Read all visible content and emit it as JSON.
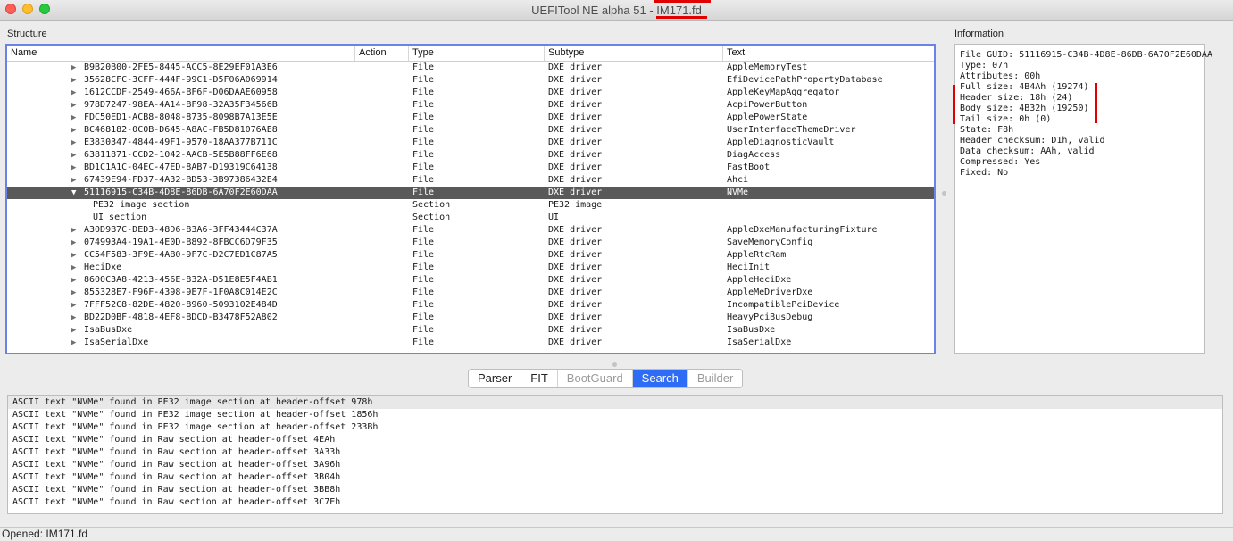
{
  "window": {
    "title_prefix": "UEFITool NE alpha 51 - ",
    "title_file": "IM171.fd"
  },
  "labels": {
    "structure": "Structure",
    "information": "Information"
  },
  "tree": {
    "columns": [
      "Name",
      "Action",
      "Type",
      "Subtype",
      "Text"
    ],
    "rows": [
      {
        "name": "B9B20B00-2FE5-8445-ACC5-8E29EF01A3E6",
        "action": "",
        "type": "File",
        "subtype": "DXE driver",
        "text": "AppleMemoryTest",
        "arrow": "▶"
      },
      {
        "name": "35628CFC-3CFF-444F-99C1-D5F06A069914",
        "action": "",
        "type": "File",
        "subtype": "DXE driver",
        "text": "EfiDevicePathPropertyDatabase",
        "arrow": "▶"
      },
      {
        "name": "1612CCDF-2549-466A-BF6F-D06DAAE60958",
        "action": "",
        "type": "File",
        "subtype": "DXE driver",
        "text": "AppleKeyMapAggregator",
        "arrow": "▶"
      },
      {
        "name": "978D7247-98EA-4A14-BF98-32A35F34566B",
        "action": "",
        "type": "File",
        "subtype": "DXE driver",
        "text": "AcpiPowerButton",
        "arrow": "▶"
      },
      {
        "name": "FDC50ED1-ACB8-8048-8735-8098B7A13E5E",
        "action": "",
        "type": "File",
        "subtype": "DXE driver",
        "text": "ApplePowerState",
        "arrow": "▶"
      },
      {
        "name": "BC468182-0C0B-D645-A8AC-FB5D81076AE8",
        "action": "",
        "type": "File",
        "subtype": "DXE driver",
        "text": "UserInterfaceThemeDriver",
        "arrow": "▶"
      },
      {
        "name": "E3830347-4844-49F1-9570-18AA377B711C",
        "action": "",
        "type": "File",
        "subtype": "DXE driver",
        "text": "AppleDiagnosticVault",
        "arrow": "▶"
      },
      {
        "name": "63811871-CCD2-1042-AACB-5E5B88FF6E68",
        "action": "",
        "type": "File",
        "subtype": "DXE driver",
        "text": "DiagAccess",
        "arrow": "▶"
      },
      {
        "name": "BD1C1A1C-04EC-47ED-8AB7-D19319C64138",
        "action": "",
        "type": "File",
        "subtype": "DXE driver",
        "text": "FastBoot",
        "arrow": "▶"
      },
      {
        "name": "67439E94-FD37-4A32-BD53-3B97386432E4",
        "action": "",
        "type": "File",
        "subtype": "DXE driver",
        "text": "Ahci",
        "arrow": "▶"
      },
      {
        "name": "51116915-C34B-4D8E-86DB-6A70F2E60DAA",
        "action": "",
        "type": "File",
        "subtype": "DXE driver",
        "text": "NVMe",
        "arrow": "▼",
        "selected": true
      },
      {
        "name": "PE32 image section",
        "action": "",
        "type": "Section",
        "subtype": "PE32 image",
        "text": "",
        "arrow": "",
        "child": true
      },
      {
        "name": "UI section",
        "action": "",
        "type": "Section",
        "subtype": "UI",
        "text": "",
        "arrow": "",
        "child": true
      },
      {
        "name": "A30D9B7C-DED3-48D6-83A6-3FF43444C37A",
        "action": "",
        "type": "File",
        "subtype": "DXE driver",
        "text": "AppleDxeManufacturingFixture",
        "arrow": "▶"
      },
      {
        "name": "074993A4-19A1-4E0D-B892-8FBCC6D79F35",
        "action": "",
        "type": "File",
        "subtype": "DXE driver",
        "text": "SaveMemoryConfig",
        "arrow": "▶"
      },
      {
        "name": "CC54F583-3F9E-4AB0-9F7C-D2C7ED1C87A5",
        "action": "",
        "type": "File",
        "subtype": "DXE driver",
        "text": "AppleRtcRam",
        "arrow": "▶"
      },
      {
        "name": "HeciDxe",
        "action": "",
        "type": "File",
        "subtype": "DXE driver",
        "text": "HeciInit",
        "arrow": "▶"
      },
      {
        "name": "8600C3A8-4213-456E-832A-D51E8E5F4AB1",
        "action": "",
        "type": "File",
        "subtype": "DXE driver",
        "text": "AppleHeciDxe",
        "arrow": "▶"
      },
      {
        "name": "855328E7-F96F-4398-9E7F-1F0A8C014E2C",
        "action": "",
        "type": "File",
        "subtype": "DXE driver",
        "text": "AppleMeDriverDxe",
        "arrow": "▶"
      },
      {
        "name": "7FFF52C8-82DE-4820-8960-5093102E484D",
        "action": "",
        "type": "File",
        "subtype": "DXE driver",
        "text": "IncompatiblePciDevice",
        "arrow": "▶"
      },
      {
        "name": "BD22D0BF-4818-4EF8-BDCD-B3478F52A802",
        "action": "",
        "type": "File",
        "subtype": "DXE driver",
        "text": "HeavyPciBusDebug",
        "arrow": "▶"
      },
      {
        "name": "IsaBusDxe",
        "action": "",
        "type": "File",
        "subtype": "DXE driver",
        "text": "IsaBusDxe",
        "arrow": "▶"
      },
      {
        "name": "IsaSerialDxe",
        "action": "",
        "type": "File",
        "subtype": "DXE driver",
        "text": "IsaSerialDxe",
        "arrow": "▶"
      }
    ]
  },
  "info": {
    "lines": [
      "File GUID: 51116915-C34B-4D8E-86DB-6A70F2E60DAA",
      "Type: 07h",
      "Attributes: 00h",
      "Full size: 4B4Ah (19274)",
      "Header size: 18h (24)",
      "Body size: 4B32h (19250)",
      "Tail size: 0h (0)",
      "State: F8h",
      "Header checksum: D1h, valid",
      "Data checksum: AAh, valid",
      "Compressed: Yes",
      "Fixed: No"
    ]
  },
  "tabs": [
    {
      "label": "Parser",
      "state": "normal"
    },
    {
      "label": "FIT",
      "state": "normal"
    },
    {
      "label": "BootGuard",
      "state": "disabled"
    },
    {
      "label": "Search",
      "state": "active"
    },
    {
      "label": "Builder",
      "state": "disabled"
    }
  ],
  "messages": [
    "ASCII text \"NVMe\" found in PE32 image section at header-offset 978h",
    "ASCII text \"NVMe\" found in PE32 image section at header-offset 1856h",
    "ASCII text \"NVMe\" found in PE32 image section at header-offset 233Bh",
    "ASCII text \"NVMe\" found in Raw section at header-offset 4EAh",
    "ASCII text \"NVMe\" found in Raw section at header-offset 3A33h",
    "ASCII text \"NVMe\" found in Raw section at header-offset 3A96h",
    "ASCII text \"NVMe\" found in Raw section at header-offset 3B04h",
    "ASCII text \"NVMe\" found in Raw section at header-offset 3BB8h",
    "ASCII text \"NVMe\" found in Raw section at header-offset 3C7Eh"
  ],
  "status": {
    "text": "Opened: IM171.fd"
  },
  "colors": {
    "highlight_red": "#e00000",
    "selection_row": "#595959",
    "active_tab": "#2e6cf6",
    "focus_border": "#6b83e6"
  }
}
